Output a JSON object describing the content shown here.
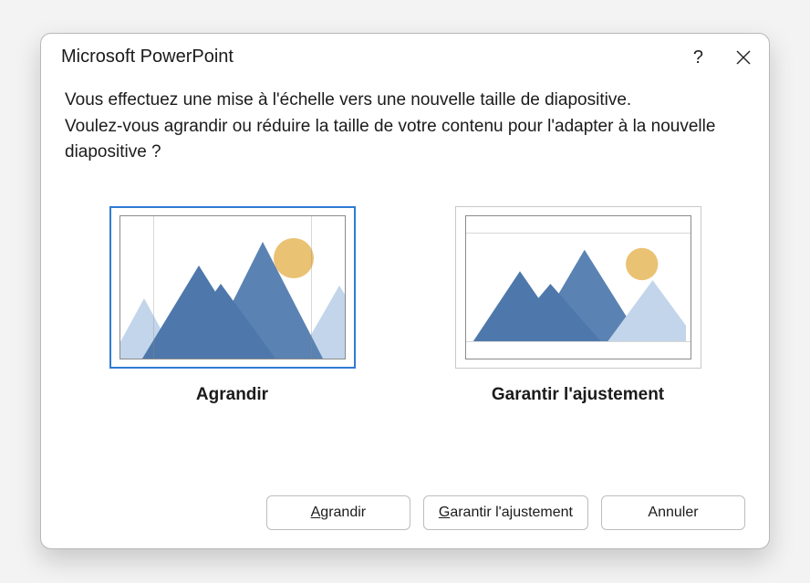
{
  "dialog": {
    "title": "Microsoft PowerPoint",
    "message_line1": "Vous effectuez une mise à l'échelle vers une nouvelle taille de diapositive.",
    "message_line2": "Voulez-vous agrandir ou réduire la taille de votre contenu pour l'adapter à la nouvelle diapositive ?"
  },
  "options": {
    "maximize": {
      "label": "Agrandir",
      "selected": true
    },
    "ensure_fit": {
      "label": "Garantir l'ajustement",
      "selected": false
    }
  },
  "buttons": {
    "maximize": {
      "prefix": "A",
      "rest": "grandir"
    },
    "ensure_fit": {
      "prefix": "G",
      "rest": "arantir l'ajustement"
    },
    "cancel": "Annuler"
  },
  "colors": {
    "mountain": "#4e78ab",
    "mountain_light": "#c2d5ea",
    "sun": "#eac273",
    "accent": "#2f7bd4"
  }
}
